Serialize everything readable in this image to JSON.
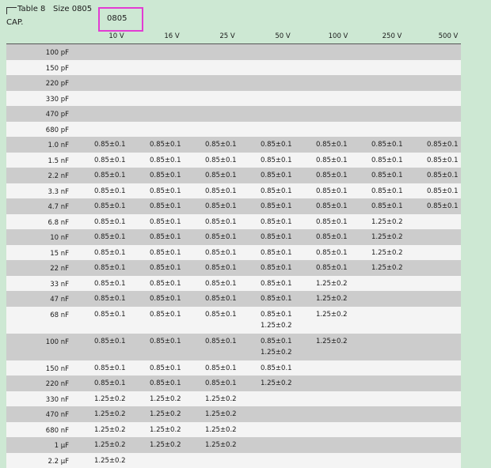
{
  "header": {
    "table_label": "Table 8",
    "size_label": "Size 0805",
    "cap_label": "CAP.",
    "highlight_label": "0805"
  },
  "voltages": [
    "10 V",
    "16 V",
    "25 V",
    "50 V",
    "100 V",
    "250 V",
    "500 V"
  ],
  "rows": [
    {
      "cap": "100 pF",
      "cells": [
        [],
        [],
        [],
        [],
        [],
        [],
        []
      ]
    },
    {
      "cap": "150 pF",
      "cells": [
        [],
        [],
        [],
        [],
        [],
        [],
        []
      ]
    },
    {
      "cap": "220 pF",
      "cells": [
        [],
        [],
        [],
        [],
        [],
        [],
        []
      ]
    },
    {
      "cap": "330 pF",
      "cells": [
        [],
        [],
        [],
        [],
        [],
        [],
        []
      ]
    },
    {
      "cap": "470 pF",
      "cells": [
        [],
        [],
        [],
        [],
        [],
        [],
        []
      ]
    },
    {
      "cap": "680 pF",
      "cells": [
        [],
        [],
        [],
        [],
        [],
        [],
        []
      ]
    },
    {
      "cap": "1.0 nF",
      "cells": [
        [
          "0.85±0.1"
        ],
        [
          "0.85±0.1"
        ],
        [
          "0.85±0.1"
        ],
        [
          "0.85±0.1"
        ],
        [
          "0.85±0.1"
        ],
        [
          "0.85±0.1"
        ],
        [
          "0.85±0.1"
        ]
      ]
    },
    {
      "cap": "1.5 nF",
      "cells": [
        [
          "0.85±0.1"
        ],
        [
          "0.85±0.1"
        ],
        [
          "0.85±0.1"
        ],
        [
          "0.85±0.1"
        ],
        [
          "0.85±0.1"
        ],
        [
          "0.85±0.1"
        ],
        [
          "0.85±0.1"
        ]
      ]
    },
    {
      "cap": "2.2 nF",
      "cells": [
        [
          "0.85±0.1"
        ],
        [
          "0.85±0.1"
        ],
        [
          "0.85±0.1"
        ],
        [
          "0.85±0.1"
        ],
        [
          "0.85±0.1"
        ],
        [
          "0.85±0.1"
        ],
        [
          "0.85±0.1"
        ]
      ]
    },
    {
      "cap": "3.3 nF",
      "cells": [
        [
          "0.85±0.1"
        ],
        [
          "0.85±0.1"
        ],
        [
          "0.85±0.1"
        ],
        [
          "0.85±0.1"
        ],
        [
          "0.85±0.1"
        ],
        [
          "0.85±0.1"
        ],
        [
          "0.85±0.1"
        ]
      ]
    },
    {
      "cap": "4.7 nF",
      "cells": [
        [
          "0.85±0.1"
        ],
        [
          "0.85±0.1"
        ],
        [
          "0.85±0.1"
        ],
        [
          "0.85±0.1"
        ],
        [
          "0.85±0.1"
        ],
        [
          "0.85±0.1"
        ],
        [
          "0.85±0.1"
        ]
      ]
    },
    {
      "cap": "6.8 nF",
      "cells": [
        [
          "0.85±0.1"
        ],
        [
          "0.85±0.1"
        ],
        [
          "0.85±0.1"
        ],
        [
          "0.85±0.1"
        ],
        [
          "0.85±0.1"
        ],
        [
          "1.25±0.2"
        ],
        []
      ]
    },
    {
      "cap": "10 nF",
      "cells": [
        [
          "0.85±0.1"
        ],
        [
          "0.85±0.1"
        ],
        [
          "0.85±0.1"
        ],
        [
          "0.85±0.1"
        ],
        [
          "0.85±0.1"
        ],
        [
          "1.25±0.2"
        ],
        []
      ]
    },
    {
      "cap": "15 nF",
      "cells": [
        [
          "0.85±0.1"
        ],
        [
          "0.85±0.1"
        ],
        [
          "0.85±0.1"
        ],
        [
          "0.85±0.1"
        ],
        [
          "0.85±0.1"
        ],
        [
          "1.25±0.2"
        ],
        []
      ]
    },
    {
      "cap": "22 nF",
      "cells": [
        [
          "0.85±0.1"
        ],
        [
          "0.85±0.1"
        ],
        [
          "0.85±0.1"
        ],
        [
          "0.85±0.1"
        ],
        [
          "0.85±0.1"
        ],
        [
          "1.25±0.2"
        ],
        []
      ]
    },
    {
      "cap": "33 nF",
      "cells": [
        [
          "0.85±0.1"
        ],
        [
          "0.85±0.1"
        ],
        [
          "0.85±0.1"
        ],
        [
          "0.85±0.1"
        ],
        [
          "1.25±0.2"
        ],
        [],
        []
      ]
    },
    {
      "cap": "47 nF",
      "cells": [
        [
          "0.85±0.1"
        ],
        [
          "0.85±0.1"
        ],
        [
          "0.85±0.1"
        ],
        [
          "0.85±0.1"
        ],
        [
          "1.25±0.2"
        ],
        [],
        []
      ]
    },
    {
      "cap": "68 nF",
      "cells": [
        [
          "0.85±0.1"
        ],
        [
          "0.85±0.1"
        ],
        [
          "0.85±0.1"
        ],
        [
          "0.85±0.1",
          "1.25±0.2"
        ],
        [
          "1.25±0.2"
        ],
        [],
        []
      ]
    },
    {
      "cap": "100 nF",
      "cells": [
        [
          "0.85±0.1"
        ],
        [
          "0.85±0.1"
        ],
        [
          "0.85±0.1"
        ],
        [
          "0.85±0.1",
          "1.25±0.2"
        ],
        [
          "1.25±0.2"
        ],
        [],
        []
      ]
    },
    {
      "cap": "150 nF",
      "cells": [
        [
          "0.85±0.1"
        ],
        [
          "0.85±0.1"
        ],
        [
          "0.85±0.1"
        ],
        [
          "0.85±0.1"
        ],
        [],
        [],
        []
      ]
    },
    {
      "cap": "220 nF",
      "cells": [
        [
          "0.85±0.1"
        ],
        [
          "0.85±0.1"
        ],
        [
          "0.85±0.1"
        ],
        [
          "1.25±0.2"
        ],
        [],
        [],
        []
      ]
    },
    {
      "cap": "330 nF",
      "cells": [
        [
          "1.25±0.2"
        ],
        [
          "1.25±0.2"
        ],
        [
          "1.25±0.2"
        ],
        [],
        [],
        [],
        []
      ]
    },
    {
      "cap": "470 nF",
      "cells": [
        [
          "1.25±0.2"
        ],
        [
          "1.25±0.2"
        ],
        [
          "1.25±0.2"
        ],
        [],
        [],
        [],
        []
      ]
    },
    {
      "cap": "680 nF",
      "cells": [
        [
          "1.25±0.2"
        ],
        [
          "1.25±0.2"
        ],
        [
          "1.25±0.2"
        ],
        [],
        [],
        [],
        []
      ]
    },
    {
      "cap": "1 μF",
      "cells": [
        [
          "1.25±0.2"
        ],
        [
          "1.25±0.2"
        ],
        [
          "1.25±0.2"
        ],
        [],
        [],
        [],
        []
      ]
    },
    {
      "cap": "2.2 μF",
      "cells": [
        [
          "1.25±0.2"
        ],
        [],
        [],
        [],
        [],
        [],
        []
      ]
    }
  ]
}
